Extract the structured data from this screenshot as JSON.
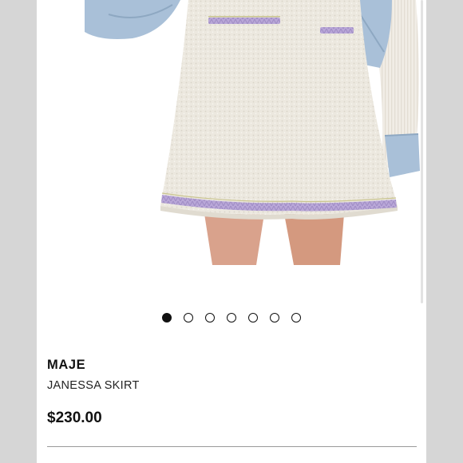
{
  "listing": {
    "brand": "MAJE",
    "title": "JANESSA SKIRT",
    "price": "$230.00"
  },
  "gallery": {
    "image_count": 7,
    "active_index": 0
  },
  "colors": {
    "background": "#d6d6d6",
    "card": "#ffffff",
    "skirt": "#ede9e0",
    "trim": "#b9a7d8",
    "denim": "#a9c0d8",
    "text": "#111111"
  }
}
